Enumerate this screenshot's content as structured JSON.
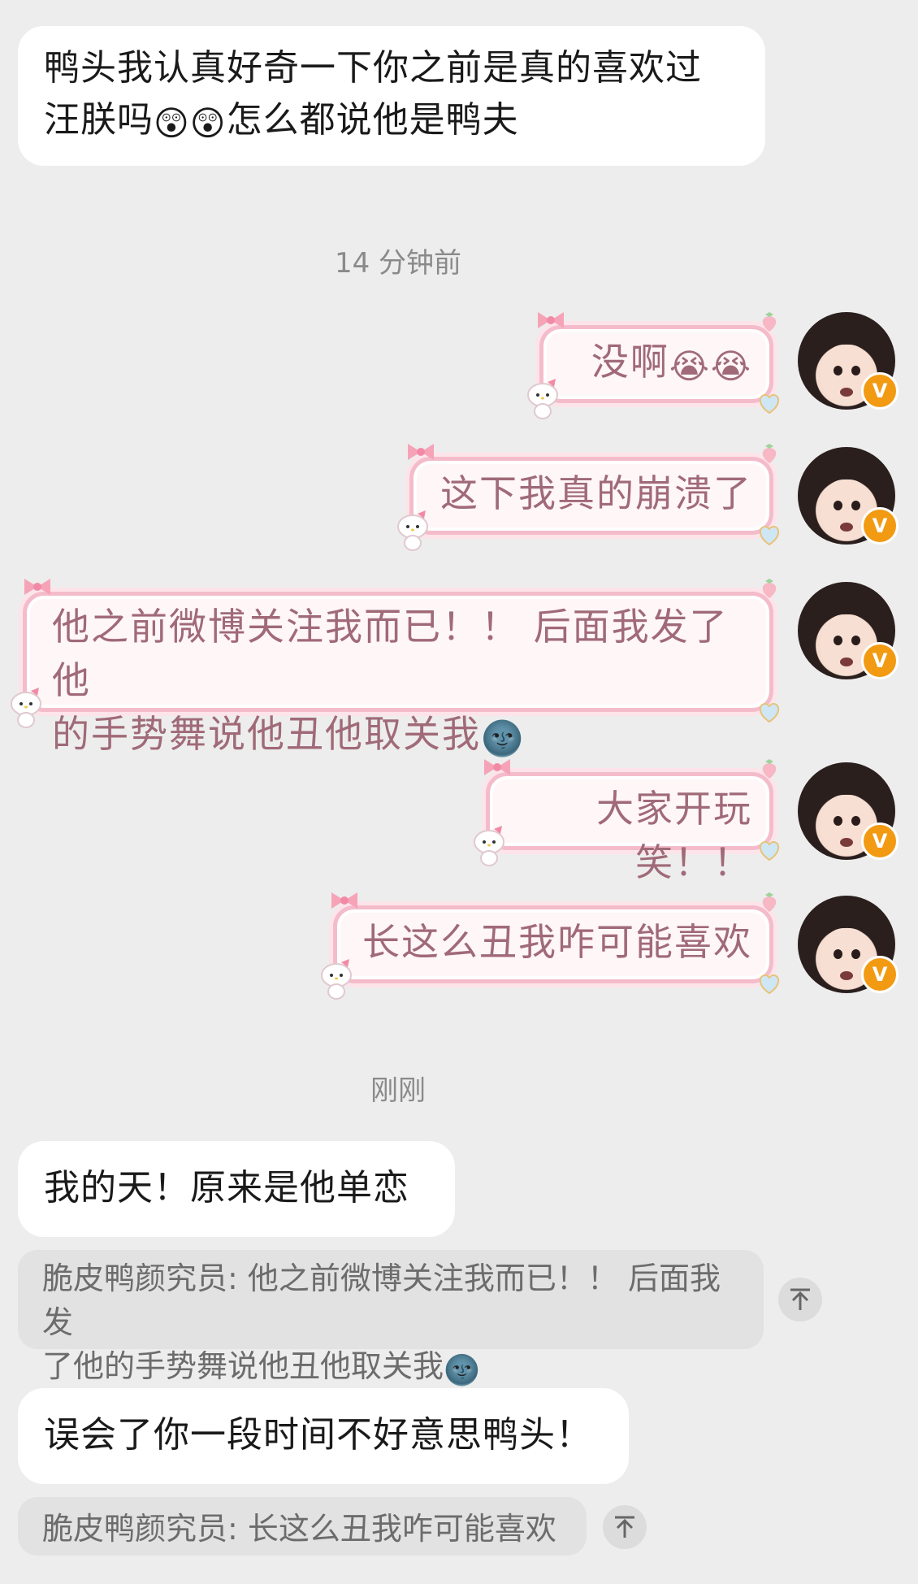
{
  "messages": {
    "m1": {
      "text": "鸭头我认真好奇一下你之前是真的喜欢过",
      "text2": "汪朕吗",
      "emoji": "😲",
      "text3": "怎么都说他是鸭夫"
    },
    "ts1": "14 分钟前",
    "o1": {
      "text": "没啊",
      "emoji": "😭"
    },
    "o2": {
      "text": "这下我真的崩溃了"
    },
    "o3": {
      "line1": "他之前微博关注我而已！！ 后面我发了他",
      "line2": "的手势舞说他丑他取关我",
      "emoji": "🌚"
    },
    "o4": {
      "text": "大家开玩笑！！"
    },
    "o5": {
      "text": "长这么丑我咋可能喜欢"
    },
    "ts2": "刚刚",
    "m2": {
      "text": "我的天！原来是他单恋"
    },
    "q1": {
      "line1": "脆皮鸭颜究员: 他之前微博关注我而已！！ 后面我发",
      "line2": "了他的手势舞说他丑他取关我",
      "emoji": "🌚"
    },
    "m3": {
      "text": "误会了你一段时间不好意思鸭头！"
    },
    "q2": {
      "text": "脆皮鸭颜究员: 长这么丑我咋可能喜欢"
    }
  },
  "avatar_badge": "V",
  "colors": {
    "bg": "#ededed",
    "bubble_frame": "#f4bccb",
    "outgoing_text": "#a06a78",
    "vip_badge": "#f29a12"
  }
}
